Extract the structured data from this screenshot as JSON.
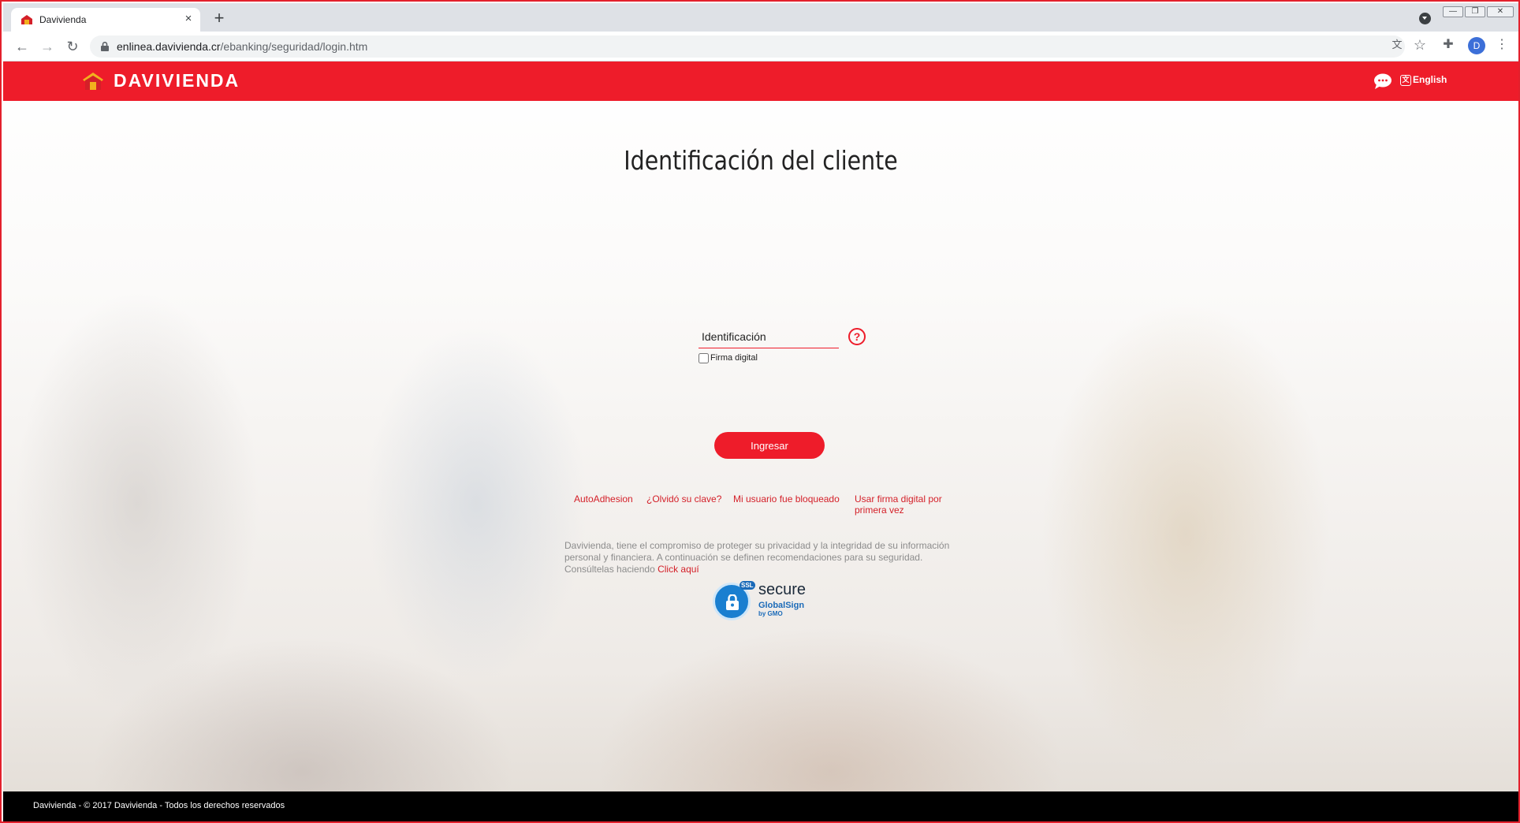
{
  "browser": {
    "tab_title": "Davivienda",
    "tab_close": "×",
    "new_tab": "+",
    "url_host": "enlinea.davivienda.cr",
    "url_path": "/ebanking/seguridad/login.htm",
    "profile_initial": "D",
    "icons": [
      "tab-favicon",
      "tab-search-icon",
      "back-icon",
      "forward-icon",
      "reload-icon",
      "lock-icon",
      "translate-icon",
      "star-icon",
      "extensions-icon",
      "menu-icon",
      "minimize-icon",
      "restore-icon",
      "close-window-icon"
    ]
  },
  "header": {
    "brand": "DAVIVIENDA",
    "language_link": "English",
    "color": "#ee1c2a"
  },
  "login": {
    "title": "Identificación del cliente",
    "id_placeholder": "Identificación",
    "firma_label": "Firma digital",
    "firma_checked": false,
    "submit_label": "Ingresar"
  },
  "links": {
    "auto_adhesion": "AutoAdhesion",
    "forgot_password": "¿Olvidó su clave?",
    "user_blocked": "Mi usuario fue bloqueado",
    "digital_signature_first": "Usar firma digital por primera vez"
  },
  "notice": {
    "text": "Davivienda, tiene el compromiso de proteger su privacidad y la integridad de su información personal y financiera. A continuación se definen recomendaciones para su seguridad. Consúltelas haciendo ",
    "link": "Click aquí"
  },
  "ssl_badge": {
    "ssl": "SSL",
    "word": "secure",
    "brand": "GlobalSign",
    "sub": "by GMO"
  },
  "footer": {
    "text": "Davivienda - © 2017 Davivienda - Todos los derechos reservados"
  }
}
